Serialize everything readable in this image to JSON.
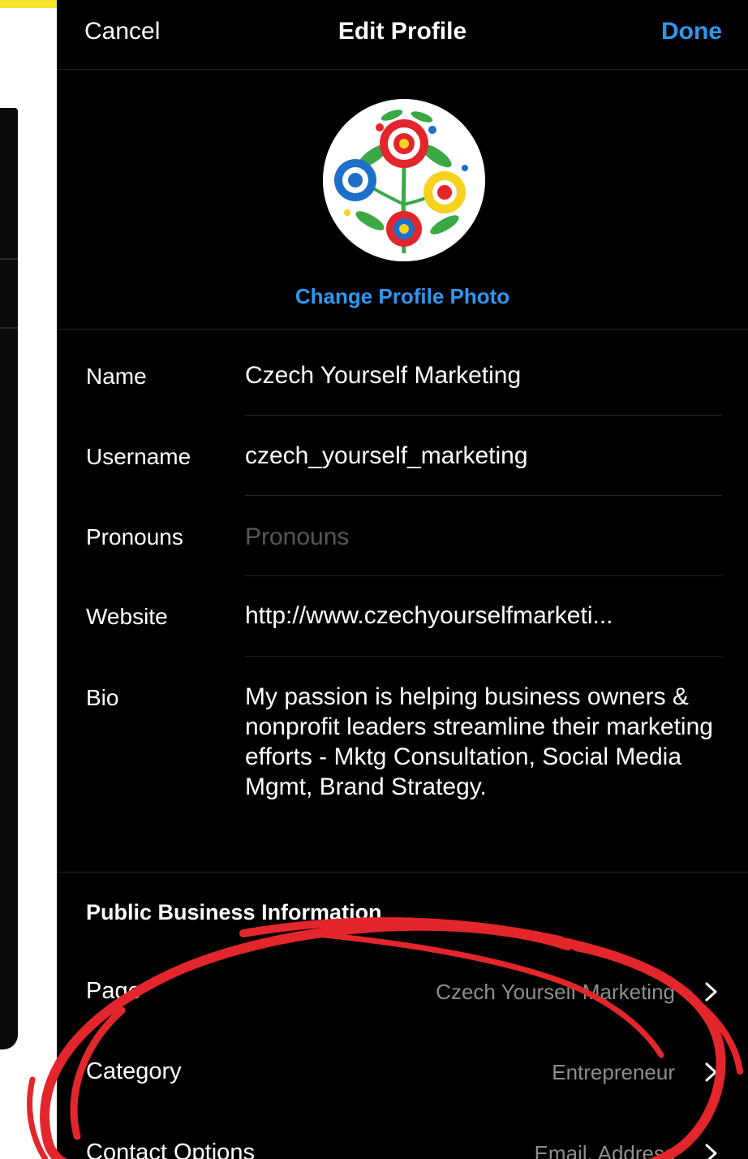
{
  "header": {
    "cancel_label": "Cancel",
    "title": "Edit Profile",
    "done_label": "Done"
  },
  "profile_photo": {
    "change_label": "Change Profile Photo"
  },
  "fields": {
    "name": {
      "label": "Name",
      "value": "Czech Yourself Marketing"
    },
    "username": {
      "label": "Username",
      "value": "czech_yourself_marketing"
    },
    "pronouns": {
      "label": "Pronouns",
      "value": "",
      "placeholder": "Pronouns"
    },
    "website": {
      "label": "Website",
      "value": "http://www.czechyourselfmarketi..."
    },
    "bio": {
      "label": "Bio",
      "value": "My passion is helping business owners & nonprofit leaders streamline their marketing efforts - Mktg Consultation, Social Media Mgmt, Brand Strategy."
    }
  },
  "business": {
    "header": "Public Business Information",
    "rows": [
      {
        "label": "Page",
        "value": "Czech Yourself Marketing"
      },
      {
        "label": "Category",
        "value": "Entrepreneur"
      },
      {
        "label": "Contact Options",
        "value": "Email, Address"
      }
    ]
  },
  "colors": {
    "accent": "#2f97f0",
    "background": "#000000",
    "annotation": "#e3262b",
    "highlight_band": "#f5e62b"
  },
  "icons": {
    "chevron": "chevron-right-icon"
  }
}
